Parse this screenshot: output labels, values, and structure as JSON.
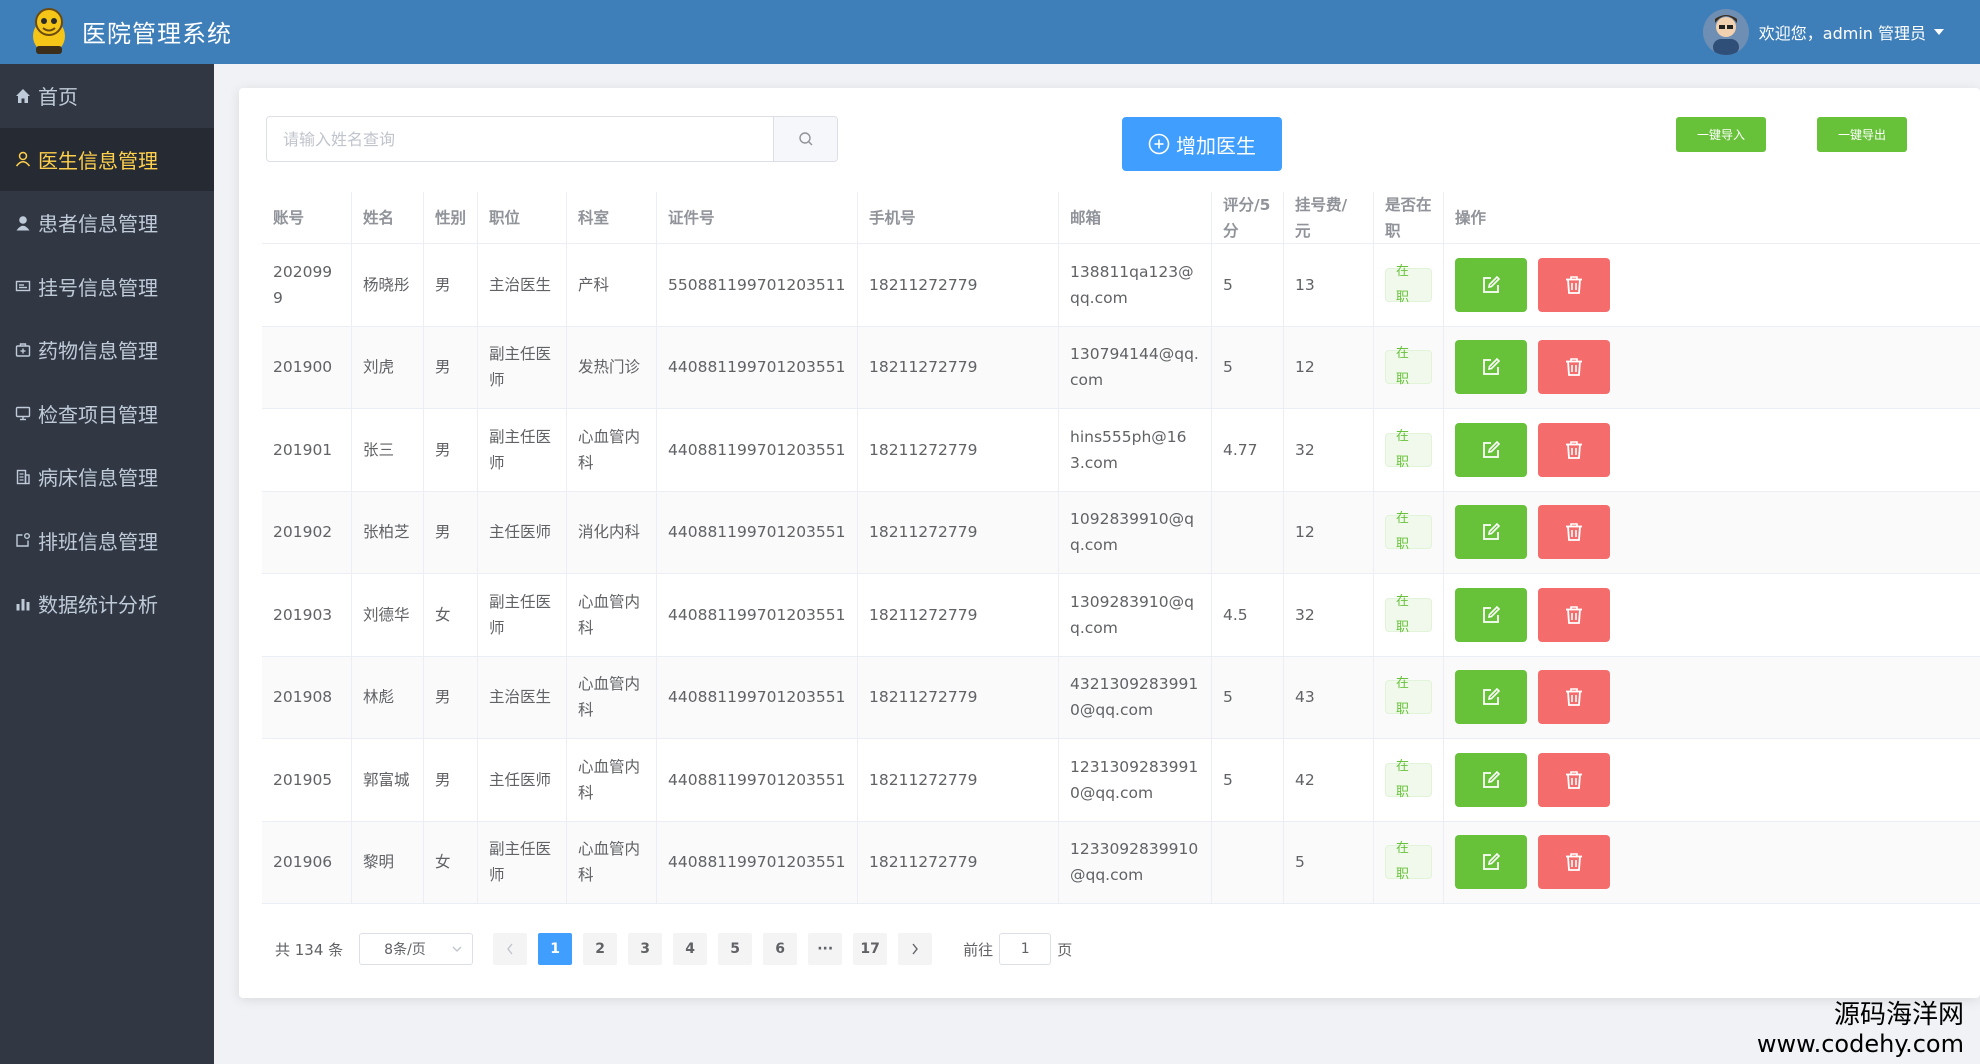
{
  "header": {
    "app_title": "医院管理系统",
    "welcome_text": "欢迎您，admin 管理员"
  },
  "sidebar": {
    "items": [
      {
        "label": "首页",
        "icon": "home-icon"
      },
      {
        "label": "医生信息管理",
        "icon": "user-outline-icon",
        "active": true
      },
      {
        "label": "患者信息管理",
        "icon": "user-solid-icon"
      },
      {
        "label": "挂号信息管理",
        "icon": "ticket-icon"
      },
      {
        "label": "药物信息管理",
        "icon": "first-aid-icon"
      },
      {
        "label": "检查项目管理",
        "icon": "monitor-icon"
      },
      {
        "label": "病床信息管理",
        "icon": "office-building-icon"
      },
      {
        "label": "排班信息管理",
        "icon": "calendar-edit-icon"
      },
      {
        "label": "数据统计分析",
        "icon": "bar-chart-icon"
      }
    ]
  },
  "toolbar": {
    "search_placeholder": "请输入姓名查询",
    "add_label": "增加医生",
    "import_label": "一键导入",
    "export_label": "一键导出"
  },
  "table": {
    "columns": [
      "账号",
      "姓名",
      "性别",
      "职位",
      "科室",
      "证件号",
      "手机号",
      "邮箱",
      "评分/5分",
      "挂号费/元",
      "是否在职",
      "操作"
    ],
    "rows": [
      {
        "account": "2020999",
        "name": "杨晓彤",
        "gender": "男",
        "title": "主治医生",
        "dept": "产科",
        "id_no": "550881199701203511",
        "phone": "18211272779",
        "email": "138811qa123@qq.com",
        "score": "5",
        "fee": "13",
        "status": "在职"
      },
      {
        "account": "201900",
        "name": "刘虎",
        "gender": "男",
        "title": "副主任医师",
        "dept": "发热门诊",
        "id_no": "440881199701203551",
        "phone": "18211272779",
        "email": "130794144@qq.com",
        "score": "5",
        "fee": "12",
        "status": "在职"
      },
      {
        "account": "201901",
        "name": "张三",
        "gender": "男",
        "title": "副主任医师",
        "dept": "心血管内科",
        "id_no": "440881199701203551",
        "phone": "18211272779",
        "email": "hins555ph@163.com",
        "score": "4.77",
        "fee": "32",
        "status": "在职"
      },
      {
        "account": "201902",
        "name": "张柏芝",
        "gender": "男",
        "title": "主任医师",
        "dept": "消化内科",
        "id_no": "440881199701203551",
        "phone": "18211272779",
        "email": "1092839910@qq.com",
        "score": "",
        "fee": "12",
        "status": "在职"
      },
      {
        "account": "201903",
        "name": "刘德华",
        "gender": "女",
        "title": "副主任医师",
        "dept": "心血管内科",
        "id_no": "440881199701203551",
        "phone": "18211272779",
        "email": "1309283910@qq.com",
        "score": "4.5",
        "fee": "32",
        "status": "在职"
      },
      {
        "account": "201908",
        "name": "林彪",
        "gender": "男",
        "title": "主治医生",
        "dept": "心血管内科",
        "id_no": "440881199701203551",
        "phone": "18211272779",
        "email": "43213092839910@qq.com",
        "score": "5",
        "fee": "43",
        "status": "在职"
      },
      {
        "account": "201905",
        "name": "郭富城",
        "gender": "男",
        "title": "主任医师",
        "dept": "心血管内科",
        "id_no": "440881199701203551",
        "phone": "18211272779",
        "email": "12313092839910@qq.com",
        "score": "5",
        "fee": "42",
        "status": "在职"
      },
      {
        "account": "201906",
        "name": "黎明",
        "gender": "女",
        "title": "副主任医师",
        "dept": "心血管内科",
        "id_no": "440881199701203551",
        "phone": "18211272779",
        "email": "1233092839910@qq.com",
        "score": "",
        "fee": "5",
        "status": "在职"
      }
    ]
  },
  "pagination": {
    "total_text": "共 134 条",
    "page_size": "8条/页",
    "pages": [
      "1",
      "2",
      "3",
      "4",
      "5",
      "6",
      "···",
      "17"
    ],
    "current_page": "1",
    "goto_prefix": "前往",
    "goto_value": "1",
    "goto_suffix": "页"
  },
  "watermark": {
    "line1": "源码海洋网",
    "line2": "www.codehy.com"
  },
  "colors": {
    "header": "#3e7fba",
    "sidebar": "#323744",
    "sidebar_active_text": "#ffd04b",
    "primary": "#409eff",
    "success": "#67c23a",
    "danger": "#f56c6c"
  }
}
